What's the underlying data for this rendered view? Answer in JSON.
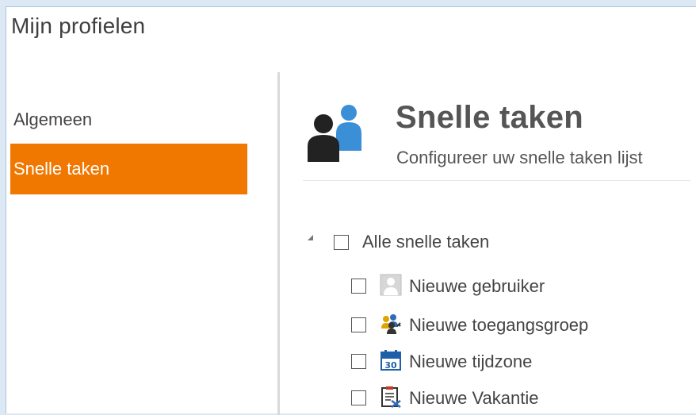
{
  "window": {
    "title": "Mijn profielen"
  },
  "sidebar": {
    "items": [
      {
        "label": "Algemeen",
        "active": false
      },
      {
        "label": "Snelle taken",
        "active": true
      }
    ]
  },
  "section": {
    "icon": "users-group-icon",
    "title": "Snelle taken",
    "subtitle": "Configureer uw snelle taken lijst"
  },
  "tree": {
    "root": {
      "label": "Alle snelle taken",
      "checked": false,
      "expanded": true
    },
    "items": [
      {
        "label": "Nieuwe gebruiker",
        "icon": "user-icon",
        "checked": false
      },
      {
        "label": "Nieuwe toegangsgroep",
        "icon": "access-group-icon",
        "checked": false
      },
      {
        "label": "Nieuwe tijdzone",
        "icon": "calendar-icon",
        "checked": false
      },
      {
        "label": "Nieuwe Vakantie",
        "icon": "holiday-clipboard-icon",
        "checked": false
      }
    ]
  },
  "colors": {
    "accent": "#f07800",
    "window_border": "#a9c4de",
    "background": "#dce9f5"
  }
}
